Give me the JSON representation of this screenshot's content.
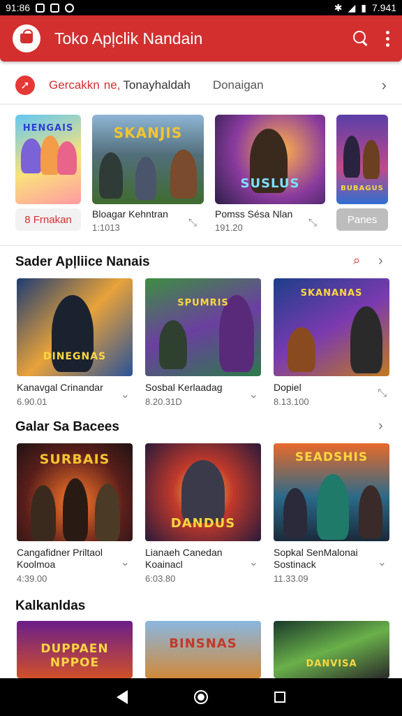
{
  "status": {
    "time": "91:86",
    "battery": "7.941"
  },
  "appbar": {
    "title": "Toko Apļclik Nandain",
    "logo_icon": "shopping-bag-icon"
  },
  "filter": {
    "chip1": "Gercakkn",
    "chip1b": "ne,",
    "chip2": "Tonayhaldah",
    "chip3": "Donaigan"
  },
  "featured": {
    "items": [
      {
        "name": "",
        "sub": "",
        "pill": "8 Frnakan",
        "label": "HENGAIS"
      },
      {
        "name": "Bloagar Kehntran",
        "sub": "1:1013",
        "label": "SKANJIS"
      },
      {
        "name": "Pomss Sésa Nlan",
        "sub": "191.20",
        "label": "SUSLUS"
      },
      {
        "name": "",
        "sub": "",
        "pill": "Panes",
        "label": "BUBAGUS"
      }
    ]
  },
  "section1": {
    "title": "Sader Apļliice Nanais",
    "items": [
      {
        "name": "Kanavgal Crinandar",
        "price": "6.90.01",
        "label": "DINEGNAS"
      },
      {
        "name": "Sosbal Kerlaadag",
        "price": "8.20.31D",
        "label": "SPUMRIS"
      },
      {
        "name": "Dopiel",
        "price": "8.13.100",
        "label": "SKANANAS"
      }
    ]
  },
  "section2": {
    "title": "Galar Sa Bacees",
    "items": [
      {
        "name": "Cangafidner Priltaol Koolmoa",
        "price": "4:39.00",
        "label": "SURBAIS"
      },
      {
        "name": "Lianaeh Canedan Koainacl",
        "price": "6:03.80",
        "label": "DANDUS"
      },
      {
        "name": "Sopkal SenMalonai Sostinack",
        "price": "11.33.09",
        "label": "SEADSHIS"
      }
    ]
  },
  "section3": {
    "title": "Kalkanldas",
    "items": [
      {
        "label": "DUPPAEN NPPOE"
      },
      {
        "label": "BINSNAS"
      },
      {
        "label": "DANVISA"
      }
    ]
  }
}
